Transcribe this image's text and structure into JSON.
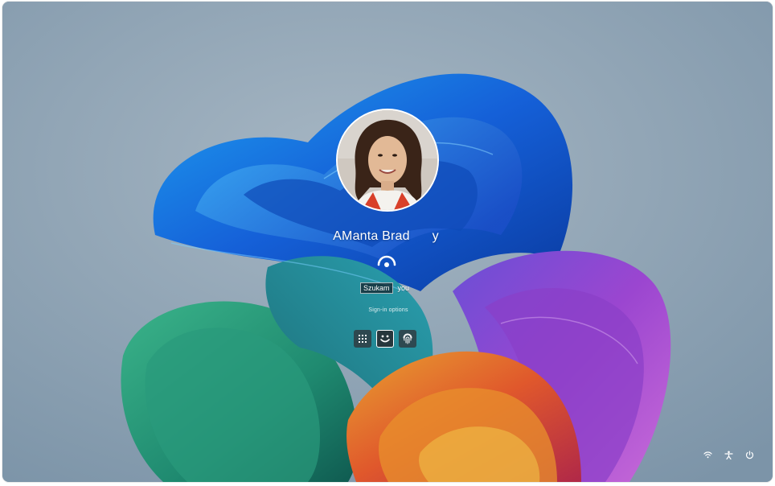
{
  "lock_screen": {
    "user": {
      "display_name": "AManta Brad      y",
      "avatar_alt": "user-profile-photo"
    },
    "face_recognition": {
      "status_text": "Szukam",
      "status_suffix": "you",
      "icon": "face-scan-icon"
    },
    "sign_in": {
      "options_label": "Sign-in options",
      "options": [
        {
          "name": "pin",
          "icon": "keypad-icon",
          "selected": false
        },
        {
          "name": "face",
          "icon": "smiley-face-icon",
          "selected": true
        },
        {
          "name": "fingerprint",
          "icon": "fingerprint-icon",
          "selected": false
        }
      ]
    },
    "tray": {
      "icons": [
        "wifi-icon",
        "accessibility-icon",
        "power-icon"
      ]
    }
  },
  "colors": {
    "background_top": "#7f97aa",
    "background_bottom": "#b5c3cf",
    "text": "#ffffff",
    "button_bg": "#323237"
  }
}
